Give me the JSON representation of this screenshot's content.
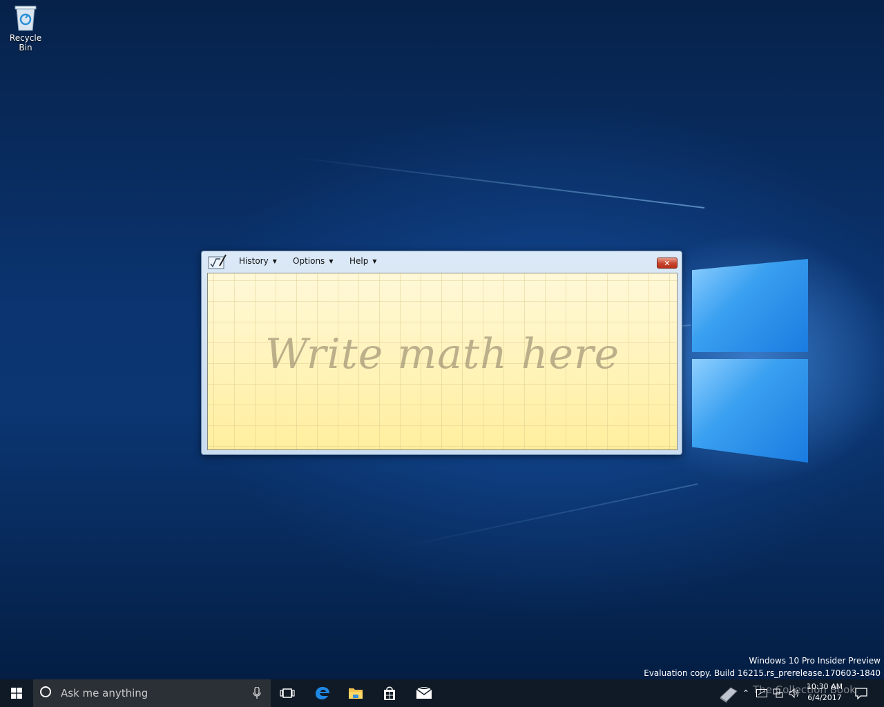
{
  "desktop": {
    "icons": [
      {
        "label": "Recycle Bin",
        "icon": "recycle-bin-icon"
      }
    ],
    "watermark": {
      "line1": "Windows 10 Pro Insider Preview",
      "line2": "Evaluation copy. Build 16215.rs_prerelease.170603-1840"
    }
  },
  "math_window": {
    "app_icon": "math-input-panel-icon",
    "menus": [
      {
        "label": "History"
      },
      {
        "label": "Options"
      },
      {
        "label": "Help"
      }
    ],
    "close_label": "✕",
    "hint": "Write math here"
  },
  "taskbar": {
    "search_placeholder": "Ask me anything",
    "pinned": [
      "task-view-icon",
      "edge-icon",
      "file-explorer-icon",
      "store-icon",
      "mail-icon"
    ],
    "tray": {
      "overlay_text": "The Collection Book",
      "time": "10:30 AM",
      "date": "6/4/2017"
    }
  },
  "colors": {
    "taskbar": "#101a26",
    "search_box": "#2b2f36",
    "note_bg": "#fff5c6",
    "close_red": "#c7432d",
    "accent_blue": "#1a7be0"
  }
}
